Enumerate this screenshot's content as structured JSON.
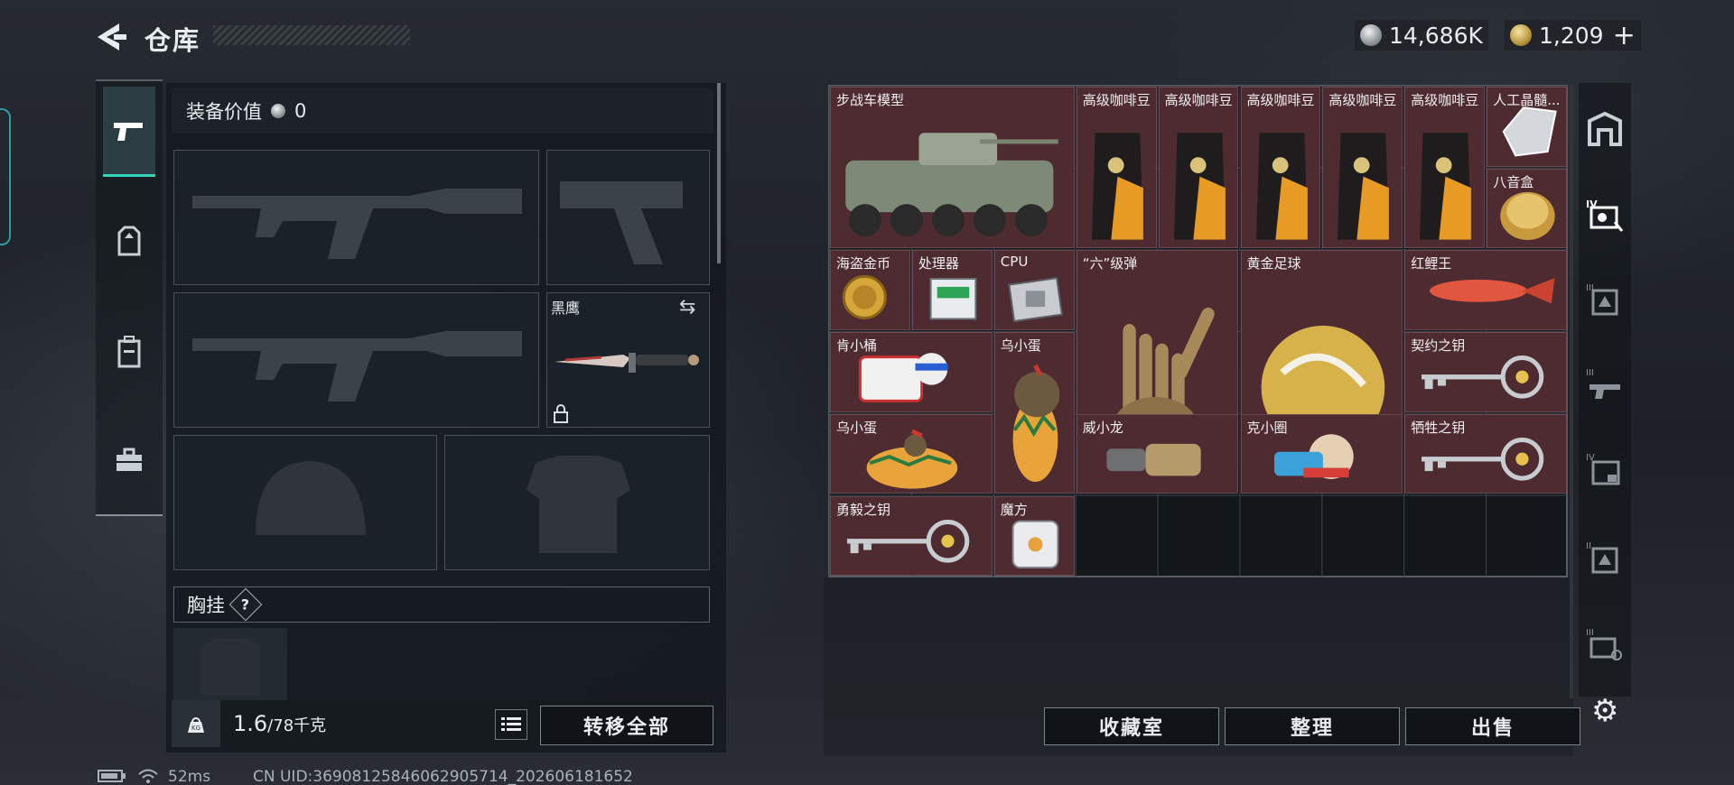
{
  "header": {
    "title": "仓库",
    "currency_silver": "14,686K",
    "currency_gold": "1,209",
    "gold_plus": "+"
  },
  "loadout": {
    "equip_value_label": "装备价值",
    "equip_value": "0",
    "knife_name": "黑鹰",
    "chest_rig_label": "胸挂",
    "help_glyph": "?",
    "weight_current": "1.6",
    "weight_max": "/78千克",
    "transfer_all_label": "转移全部"
  },
  "stash": {
    "items": [
      {
        "name": "步战车模型",
        "icon": "ifv-model"
      },
      {
        "name": "高级咖啡豆",
        "icon": "coffee-bag"
      },
      {
        "name": "高级咖啡豆",
        "icon": "coffee-bag"
      },
      {
        "name": "高级咖啡豆",
        "icon": "coffee-bag"
      },
      {
        "name": "高级咖啡豆",
        "icon": "coffee-bag"
      },
      {
        "name": "高级咖啡豆",
        "icon": "coffee-bag"
      },
      {
        "name": "人工晶髓...",
        "icon": "crystal"
      },
      {
        "name": "八音盒",
        "icon": "music-box"
      },
      {
        "name": "海盗金币",
        "icon": "gold-coin"
      },
      {
        "name": "处理器",
        "icon": "processor"
      },
      {
        "name": "CPU",
        "icon": "cpu-chip"
      },
      {
        "name": "“六”级弹",
        "icon": "bullet-hand"
      },
      {
        "name": "黄金足球",
        "icon": "gold-football"
      },
      {
        "name": "红鲤王",
        "icon": "red-carp"
      },
      {
        "name": "肯小桶",
        "icon": "figure-bucket"
      },
      {
        "name": "乌小蛋",
        "icon": "figure-egg"
      },
      {
        "name": "契约之钥",
        "icon": "key"
      },
      {
        "name": "乌小蛋",
        "icon": "figure-egg"
      },
      {
        "name": "威小龙",
        "icon": "figure-dragon"
      },
      {
        "name": "克小圈",
        "icon": "figure-ring"
      },
      {
        "name": "牺牲之钥",
        "icon": "key"
      },
      {
        "name": "勇毅之钥",
        "icon": "key"
      },
      {
        "name": "魔方",
        "icon": "cube"
      }
    ],
    "buttons": {
      "collection": "收藏室",
      "sort": "整理",
      "sell": "出售"
    }
  },
  "status_bar": {
    "ping": "52ms",
    "uid": "CN UID:3690812584606290571​4_202606181652"
  },
  "colors": {
    "accent_teal": "#34d4b8",
    "item_cell_bg": "#4d2b31",
    "panel_border": "#555c64"
  }
}
